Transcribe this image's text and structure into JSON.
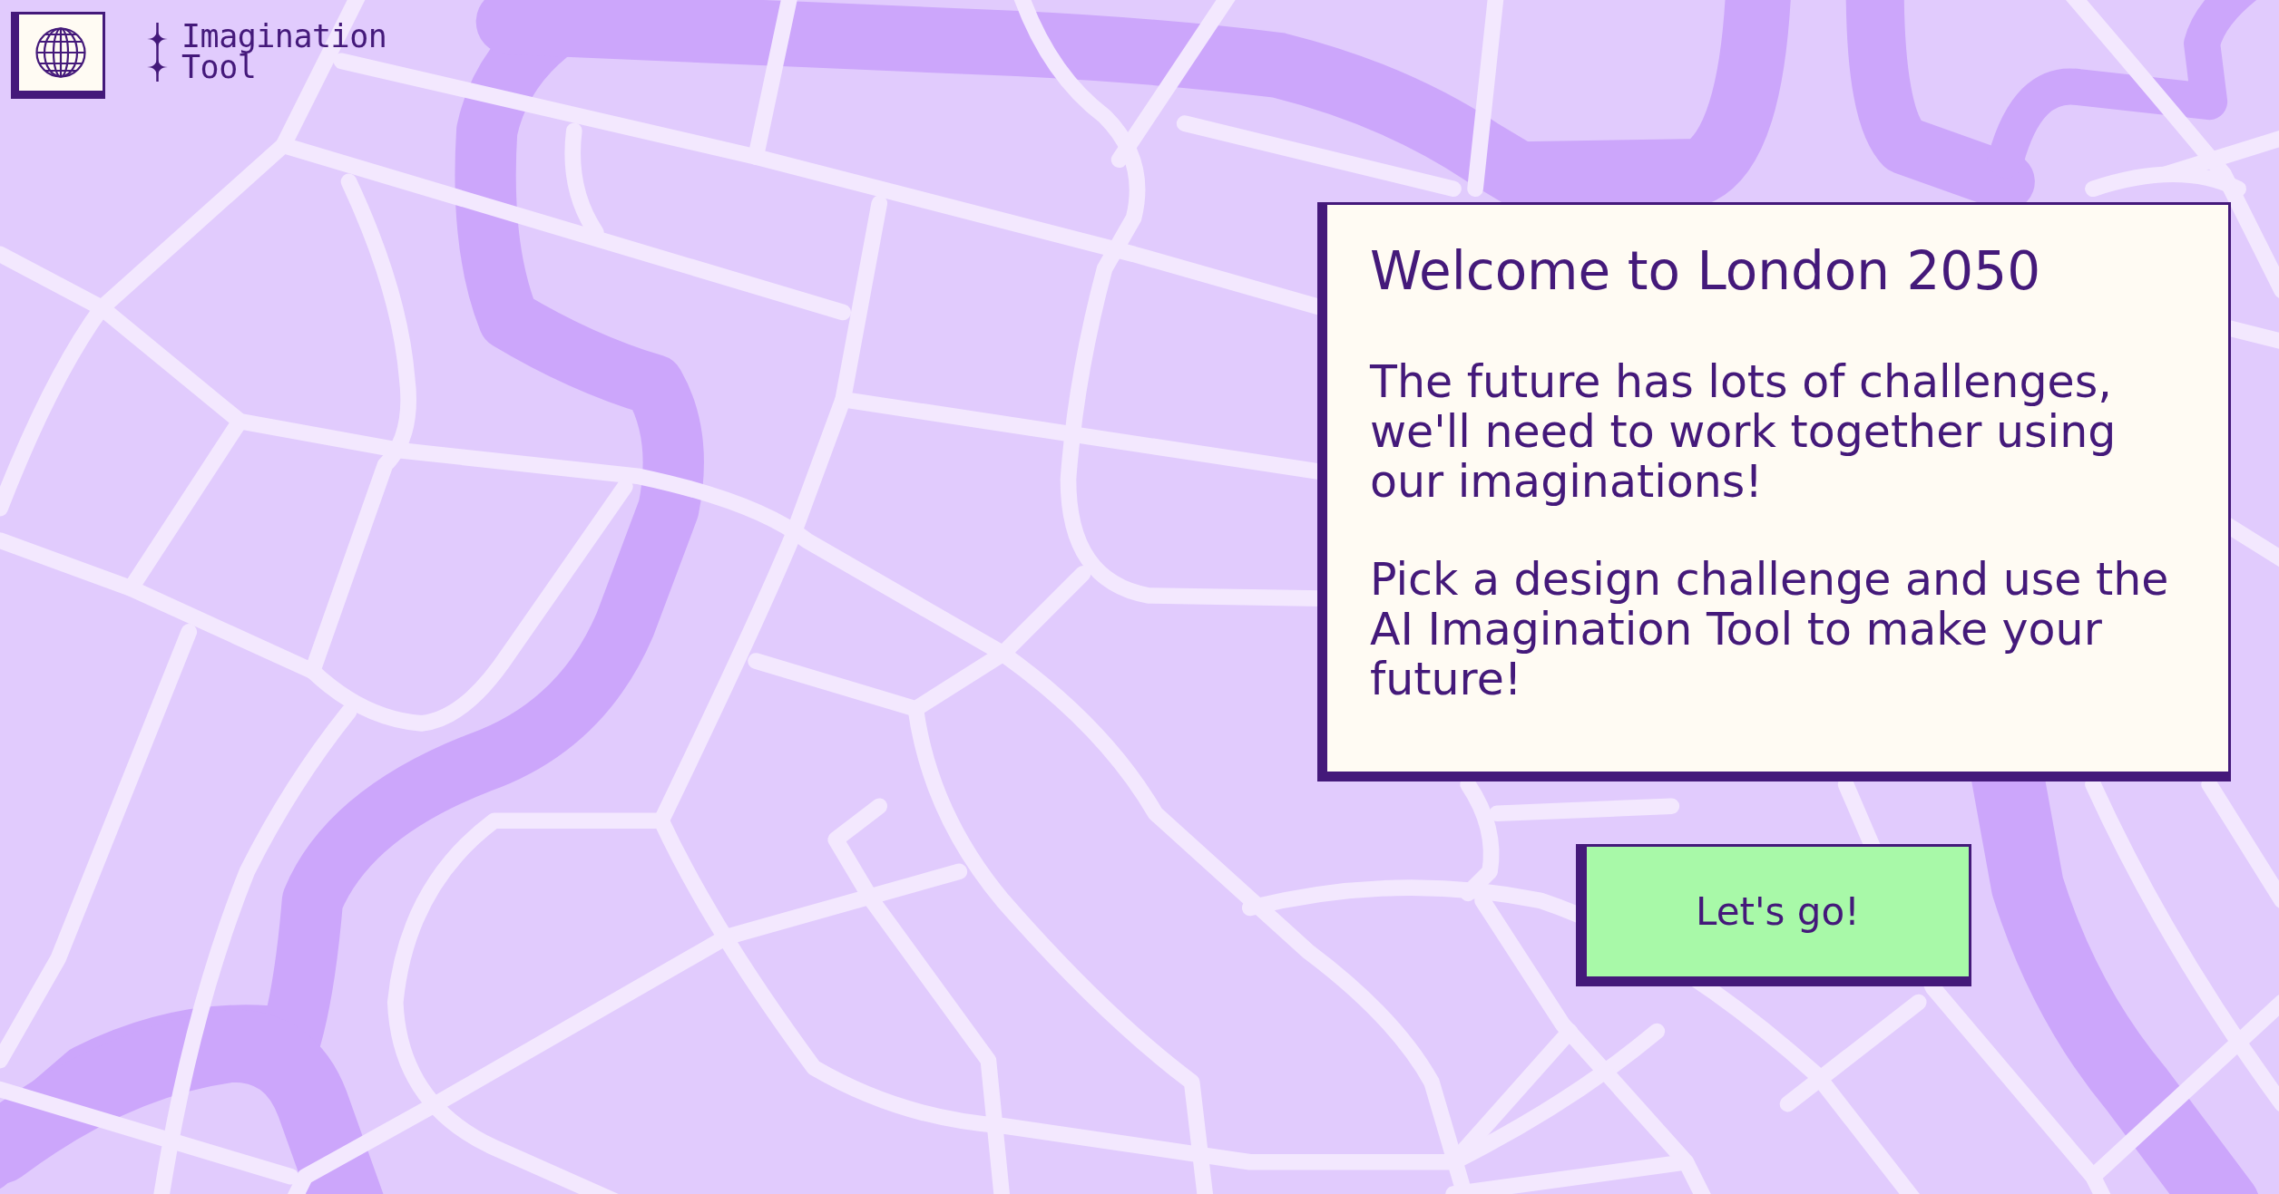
{
  "logo": {
    "wordmark": "Imagination Tool"
  },
  "welcome_card": {
    "title": "Welcome to London 2050",
    "paragraphs": [
      "The future has lots of challenges, we'll need to work together using our imaginations!",
      "Pick a design challenge and use the AI Imagination Tool to make your future!"
    ]
  },
  "start_button": {
    "label": "Let's go!"
  }
}
